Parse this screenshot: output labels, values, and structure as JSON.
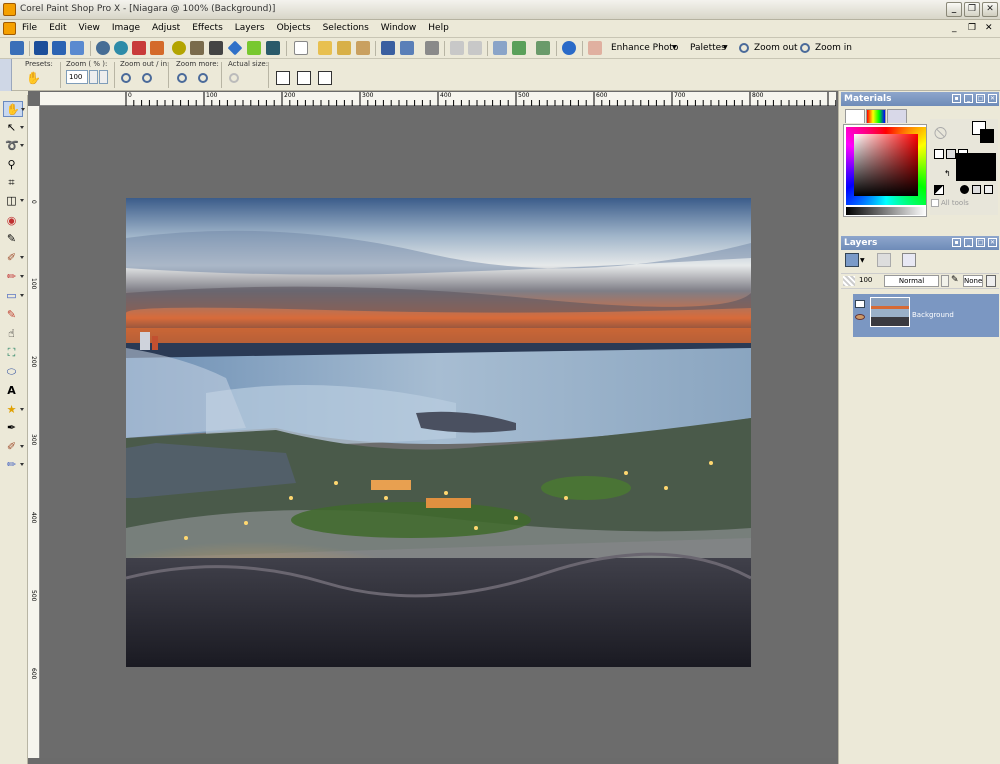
{
  "window": {
    "title": "Corel Paint Shop Pro X - [Niagara @ 100% (Background)]",
    "controls": [
      "_",
      "❐",
      "✕"
    ]
  },
  "menu": {
    "items": [
      "File",
      "Edit",
      "View",
      "Image",
      "Adjust",
      "Effects",
      "Layers",
      "Objects",
      "Selections",
      "Window",
      "Help"
    ],
    "mdi_controls": [
      "_",
      "❐",
      "✕"
    ]
  },
  "toolbar": {
    "enhance_photo": "Enhance Photo",
    "palettes": "Palettes",
    "zoom_out": "Zoom out",
    "zoom_in": "Zoom in"
  },
  "tool_options": {
    "presets_label": "Presets:",
    "zoom_label": "Zoom ( % ):",
    "zoom_value": "100",
    "zoom_out_in_label": "Zoom out / in:",
    "zoom_more_label": "Zoom more:",
    "actual_size_label": "Actual size:"
  },
  "rulers": {
    "top_ticks": [
      "0",
      "100",
      "200",
      "300",
      "400",
      "500",
      "600",
      "700",
      "800"
    ],
    "left_ticks": [
      "0",
      "100",
      "200",
      "300",
      "400",
      "500",
      "600"
    ]
  },
  "materials": {
    "title": "Materials",
    "all_tools_label": "All tools",
    "foreground_color": "#ffffff",
    "background_color": "#000000"
  },
  "layers": {
    "title": "Layers",
    "opacity": "100",
    "blend_mode": "Normal",
    "lock": "None",
    "items": [
      {
        "name": "Background"
      }
    ]
  },
  "colors": {
    "accent": "#7b97c2",
    "canvas_bg": "#6b6b6b",
    "chrome": "#ece9d8"
  }
}
